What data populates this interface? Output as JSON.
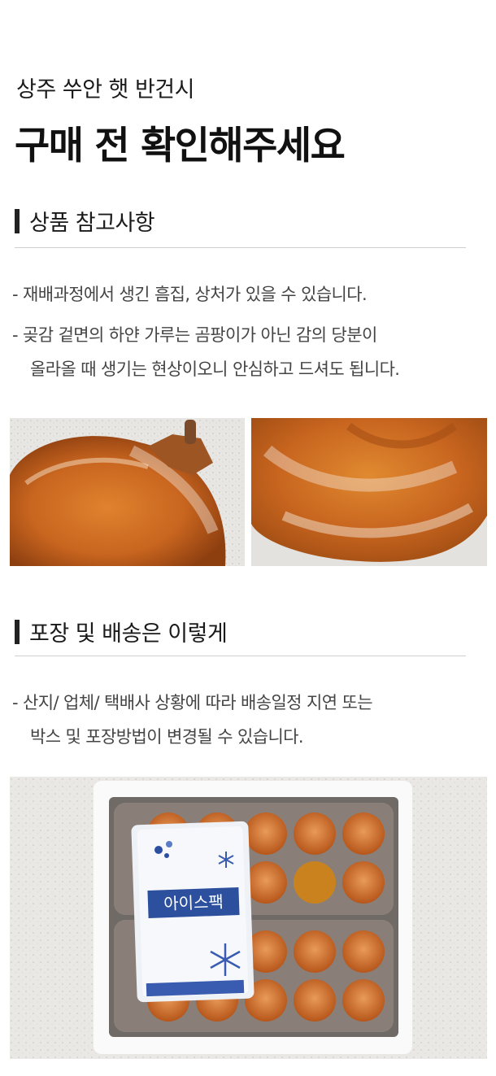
{
  "header": {
    "subtitle": "상주 쑤안 햇 반건시",
    "title": "구매 전 확인해주세요"
  },
  "section1": {
    "heading": "상품 참고사항",
    "notes": [
      [
        "- 재배과정에서 생긴 흠집, 상처가 있을 수 있습니다."
      ],
      [
        "- 곶감 겉면의 하얀 가루는 곰팡이가 아닌 감의 당분이",
        "올라올 때 생기는 현상이오니 안심하고 드셔도 됩니다."
      ]
    ]
  },
  "section2": {
    "heading": "포장 및 배송은 이렇게",
    "notes": [
      [
        "- 산지/ 업체/ 택배사 상황에 따라 배송일정 지연 또는",
        "박스 및 포장방법이 변경될 수 있습니다."
      ]
    ]
  },
  "icepack": {
    "label": "아이스팩"
  },
  "colors": {
    "persimmon": "#c8651f",
    "heading_bar": "#222222",
    "rule": "#cfcfcf"
  }
}
